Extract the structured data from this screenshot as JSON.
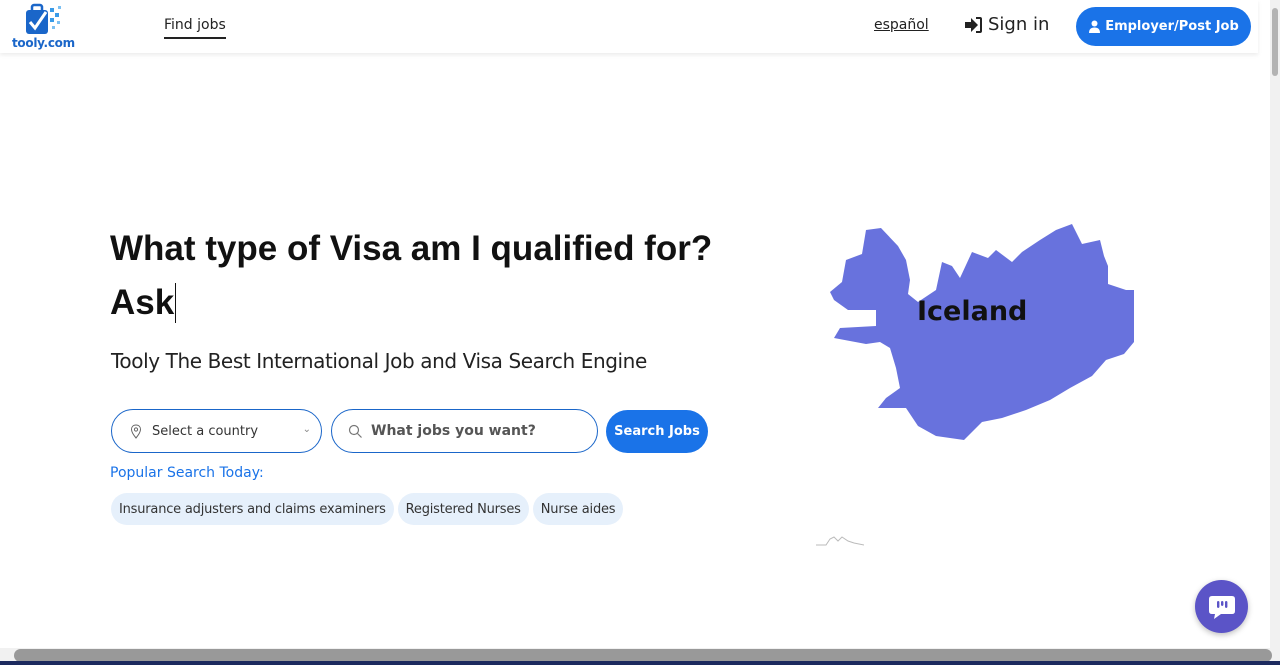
{
  "header": {
    "logo_text": "tooly.com",
    "nav_find_jobs": "Find jobs",
    "language_link": "español",
    "sign_in_label": "Sign in",
    "employer_button_label": "Employer/Post Job"
  },
  "hero": {
    "headline_line1": "What type of Visa am I qualified for?",
    "headline_line2": "Ask",
    "subtitle": "Tooly The Best International Job and Visa Search Engine"
  },
  "search": {
    "country_select_value": "Select a country",
    "job_input_placeholder": "What jobs you want?",
    "search_button_label": "Search Jobs"
  },
  "popular": {
    "label": "Popular Search Today:",
    "chips": [
      "Insurance adjusters and claims examiners",
      "Registered Nurses",
      "Nurse aides"
    ]
  },
  "map": {
    "country_label": "Iceland",
    "fill_color": "#6872dd"
  },
  "colors": {
    "accent": "#1a73e8",
    "chip_bg": "#e6f0fb",
    "chat_bg": "#5b54c7"
  },
  "icons": {
    "sign_in": "sign-in-arrow-icon",
    "employer": "user-icon",
    "country": "map-pin-icon",
    "search": "search-icon",
    "chat": "chat-bubble-icon"
  }
}
